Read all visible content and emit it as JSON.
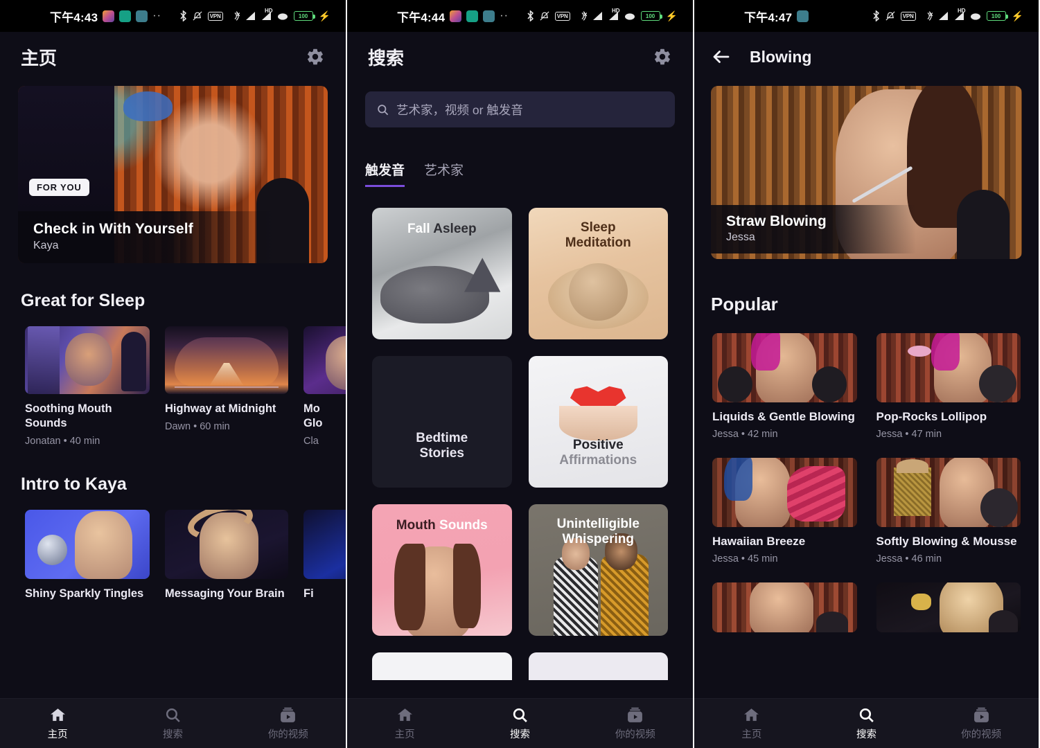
{
  "screens": [
    {
      "id": "home",
      "statusbar": {
        "time": "下午4:43",
        "battery": "100",
        "vpn": "VPN",
        "hd": "HD",
        "app_icons": [
          "photos-icon",
          "shield-icon",
          "key-icon"
        ],
        "overflow": "··"
      },
      "header": {
        "title": "主页",
        "settings_icon": "gear-icon"
      },
      "hero": {
        "badge": "FOR YOU",
        "title": "Check in With Yourself",
        "subtitle": "Kaya"
      },
      "sections": [
        {
          "title": "Great for Sleep",
          "items": [
            {
              "name": "Soothing Mouth Sounds",
              "meta": "Jonatan • 40 min"
            },
            {
              "name": "Highway at Midnight",
              "meta": "Dawn • 60 min"
            },
            {
              "name": "Mo\nGlo",
              "meta": "Cla"
            }
          ]
        },
        {
          "title": "Intro to Kaya",
          "items": [
            {
              "name": "Shiny Sparkly Tingles",
              "meta": ""
            },
            {
              "name": "Messaging Your Brain",
              "meta": ""
            },
            {
              "name": "Fi",
              "meta": ""
            }
          ]
        }
      ],
      "nav": {
        "active": "搜索-none",
        "items": [
          {
            "label": "主页",
            "icon": "home-icon",
            "active": true
          },
          {
            "label": "搜索",
            "icon": "search-icon",
            "active": false
          },
          {
            "label": "你的视频",
            "icon": "your-videos-icon",
            "active": false
          }
        ]
      }
    },
    {
      "id": "search",
      "statusbar": {
        "time": "下午4:44",
        "battery": "100",
        "vpn": "VPN",
        "hd": "HD",
        "app_icons": [
          "photos-icon",
          "shield-icon",
          "key-icon"
        ],
        "overflow": "··"
      },
      "header": {
        "title": "搜索",
        "settings_icon": "gear-icon"
      },
      "search": {
        "placeholder": "艺术家，视频 or 触发音",
        "icon": "search-icon"
      },
      "tabs": [
        {
          "label": "触发音",
          "active": true
        },
        {
          "label": "艺术家",
          "active": false
        }
      ],
      "cards": [
        {
          "line1": "Fall ",
          "line2": "Asleep",
          "style": "photo-cat"
        },
        {
          "line1": "Sleep",
          "line2": "Meditation",
          "style": "sand"
        },
        {
          "line1": "Bedtime",
          "line2": "Stories",
          "style": "dark"
        },
        {
          "line1": "Positive",
          "line2": "Affirmations",
          "style": "white-heart"
        },
        {
          "line1": "Mouth ",
          "line2": "Sounds",
          "style": "pink"
        },
        {
          "line1": "Unintelligible",
          "line2": "Whispering",
          "style": "gray"
        }
      ],
      "nav": {
        "items": [
          {
            "label": "主页",
            "icon": "home-icon",
            "active": false
          },
          {
            "label": "搜索",
            "icon": "search-icon",
            "active": true
          },
          {
            "label": "你的视频",
            "icon": "your-videos-icon",
            "active": false
          }
        ]
      }
    },
    {
      "id": "blowing",
      "statusbar": {
        "time": "下午4:47",
        "battery": "100",
        "vpn": "VPN",
        "hd": "HD",
        "app_icons": [
          "key-icon"
        ],
        "overflow": ""
      },
      "header": {
        "title": "Blowing",
        "back_icon": "back-arrow-icon"
      },
      "hero": {
        "title": "Straw Blowing",
        "subtitle": "Jessa"
      },
      "section_title": "Popular",
      "items": [
        {
          "name": "Liquids & Gentle Blowing",
          "meta": "Jessa • 42 min"
        },
        {
          "name": "Pop-Rocks Lollipop",
          "meta": "Jessa • 47 min"
        },
        {
          "name": "Hawaiian Breeze",
          "meta": "Jessa • 45 min"
        },
        {
          "name": "Softly Blowing & Mousse",
          "meta": "Jessa • 46 min"
        }
      ],
      "nav": {
        "items": [
          {
            "label": "主页",
            "icon": "home-icon",
            "active": false
          },
          {
            "label": "搜索",
            "icon": "search-icon",
            "active": true
          },
          {
            "label": "你的视频",
            "icon": "your-videos-icon",
            "active": false
          }
        ]
      }
    }
  ],
  "colors": {
    "bg": "#0e0d17",
    "accent": "#7b4ddb",
    "nav_bg": "#16151f",
    "text": "#f2f1f6",
    "muted": "#9795a6",
    "battery": "#5fdc7d"
  }
}
